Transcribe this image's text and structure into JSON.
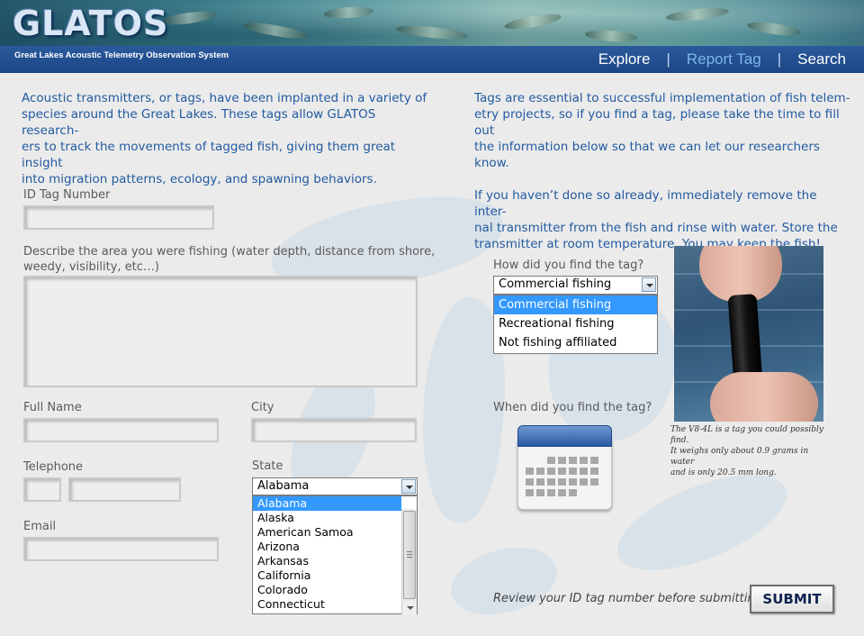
{
  "header": {
    "logo": "GLATOS",
    "tagline": "Great Lakes Acoustic Telemetry Observation System",
    "nav": [
      {
        "label": "Explore"
      },
      {
        "label": "Report Tag"
      },
      {
        "label": "Search"
      }
    ],
    "nav_separator": "|",
    "active_nav": "Report Tag",
    "colors": {
      "navbar": "#1c4586",
      "active_nav": "#7fb7e8",
      "intro_text": "#225aa0"
    }
  },
  "intro_left": "Acoustic transmitters, or tags, have been implanted in a variety of species around the Great Lakes.  These tags allow GLATOS researchers to track the movements of tagged fish, giving them great insight into migration patterns, ecology, and spawning behaviors.",
  "intro_left_lines": [
    "Acoustic transmitters, or tags, have been implanted in a variety of",
    "species around the Great Lakes.  These tags allow GLATOS research-",
    "ers to track the movements of tagged fish, giving them great insight",
    "into migration patterns, ecology, and spawning behaviors."
  ],
  "intro_right_lines_1": [
    "Tags are essential to successful implementation of fish telem-",
    "etry projects, so if you find a tag, please take the time to fill out",
    "the information below so that we can let our researchers know."
  ],
  "intro_right_lines_2": [
    "If you haven’t done so already, immediately remove the inter-",
    "nal transmitter from the fish and rinse with water.  Store the",
    "transmitter at room temperature.  You may keep the fish!"
  ],
  "form": {
    "id_tag_label": "ID Tag Number",
    "id_tag_value": "",
    "describe_label_lines": [
      "Describe the area you were fishing (water depth, distance from shore,",
      "weedy, visibility, etc…)"
    ],
    "describe_value": "",
    "full_name_label": "Full Name",
    "full_name_value": "",
    "city_label": "City",
    "city_value": "",
    "telephone_label": "Telephone",
    "telephone_area_value": "",
    "telephone_number_value": "",
    "state_label": "State",
    "state_selected": "Alabama",
    "state_options": [
      "Alabama",
      "Alaska",
      "American Samoa",
      "Arizona",
      "Arkansas",
      "California",
      "Colorado",
      "Connecticut"
    ],
    "email_label": "Email",
    "email_value": "",
    "how_found_label": "How did you find the tag?",
    "how_found_selected": "Commercial fishing",
    "how_found_options": [
      "Commercial fishing",
      "Recreational fishing",
      "Not fishing affiliated"
    ],
    "when_found_label": "When did you find the tag?",
    "calendar_icon": "calendar-icon",
    "photo_caption_lines": [
      "The V8-4L is a tag you could possibly find.",
      "It weighs only about 0.9 grams in water",
      "and is only 20.5 mm long."
    ],
    "review_text": "Review your ID tag number before submitting.",
    "submit_label": "SUBMIT"
  }
}
